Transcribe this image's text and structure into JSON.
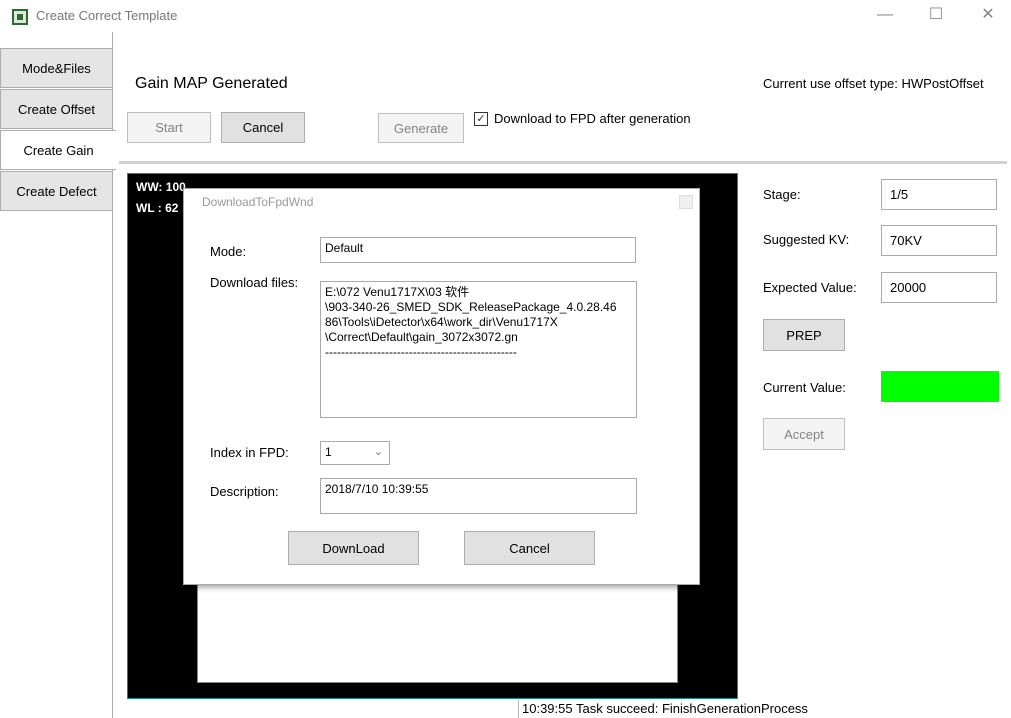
{
  "window": {
    "title": "Create Correct Template",
    "minimize": "—",
    "maximize": "☐",
    "close": "✕"
  },
  "tabs": [
    {
      "label": "Mode&Files"
    },
    {
      "label": "Create Offset"
    },
    {
      "label": "Create Gain"
    },
    {
      "label": "Create Defect"
    }
  ],
  "header": {
    "title": "Gain MAP Generated",
    "offset_type": "Current use offset type: HWPostOffset"
  },
  "toolbar": {
    "start": "Start",
    "cancel": "Cancel",
    "generate": "Generate",
    "download_after_generation": "Download to FPD after generation",
    "download_checked": true
  },
  "image": {
    "ww": "WW:  100",
    "wl": "WL :  62"
  },
  "dialog": {
    "title": "DownloadToFpdWnd",
    "mode_label": "Mode:",
    "mode_value": "Default",
    "files_label": "Download files:",
    "files_value": "E:\\072 Venu1717X\\03 软件\n\\903-340-26_SMED_SDK_ReleasePackage_4.0.28.46\n86\\Tools\\iDetector\\x64\\work_dir\\Venu1717X\n\\Correct\\Default\\gain_3072x3072.gn\n------------------------------------------------",
    "index_label": "Index in FPD:",
    "index_value": "1",
    "desc_label": "Description:",
    "desc_value": "2018/7/10 10:39:55",
    "download_button": "DownLoad",
    "cancel_button": "Cancel"
  },
  "right_panel": {
    "stage_label": "Stage:",
    "stage_value": "1/5",
    "kv_label": "Suggested KV:",
    "kv_value": "70KV",
    "expected_label": "Expected Value:",
    "expected_value": "20000",
    "prep_button": "PREP",
    "current_label": "Current Value:",
    "current_color": "#00ff00",
    "accept_button": "Accept"
  },
  "status": {
    "message": "10:39:55 Task succeed: FinishGenerationProcess"
  }
}
